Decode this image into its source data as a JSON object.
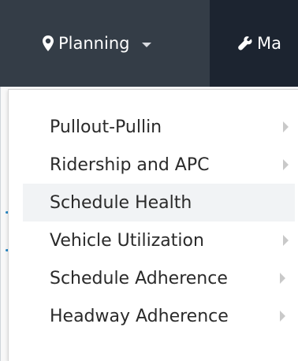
{
  "navbar": {
    "items": [
      {
        "label": "Planning",
        "icon": "map-marker-icon",
        "has_caret": true,
        "state": "active"
      },
      {
        "label": "Ma",
        "icon": "wrench-icon",
        "has_caret": false,
        "state": "normal"
      }
    ]
  },
  "dropdown": {
    "items": [
      {
        "label": "Pullout-Pullin",
        "has_submenu": true
      },
      {
        "label": "Ridership and APC",
        "has_submenu": true
      },
      {
        "label": "Schedule Health",
        "has_submenu": false,
        "highlighted": true
      },
      {
        "label": "Vehicle Utilization",
        "has_submenu": true
      },
      {
        "label": "Schedule Adherence",
        "has_submenu": true
      },
      {
        "label": "Headway Adherence",
        "has_submenu": true
      }
    ]
  },
  "colors": {
    "navbar_bg": "#1c2430",
    "active_nav_bg": "#343d47",
    "nav_text": "#ffffff",
    "dropdown_bg": "#ffffff",
    "menu_text": "#2a2a2a",
    "highlight_bg": "#f1f3f5",
    "submenu_arrow": "#c9c9c9",
    "accent_blue": "#2b8ac7"
  }
}
